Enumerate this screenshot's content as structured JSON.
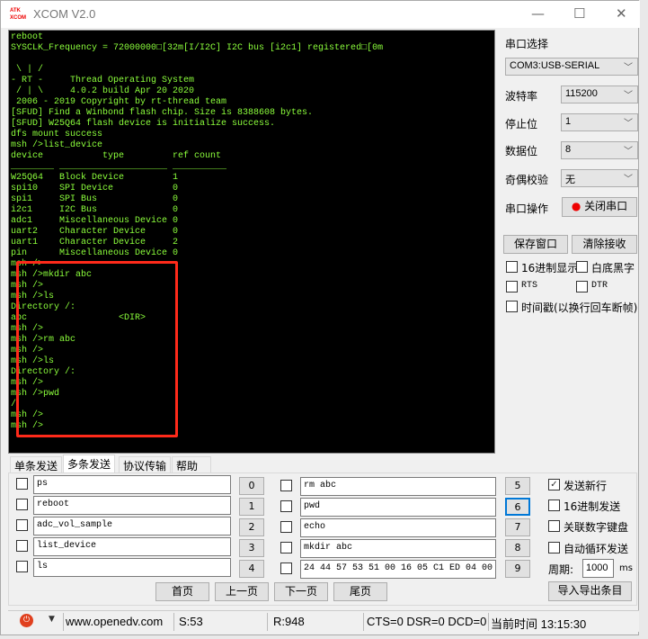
{
  "window": {
    "title": "XCOM V2.0",
    "logo": "ATK XCOM",
    "minimize": "—",
    "maximize": "☐",
    "close": "✕"
  },
  "terminal": {
    "lines": [
      "reboot",
      "SYSCLK_Frequency = 72000000□[32m[I/I2C] I2C bus [i2c1] registered□[0m",
      "",
      " \\ | /",
      "- RT -     Thread Operating System",
      " / | \\     4.0.2 build Apr 20 2020",
      " 2006 - 2019 Copyright by rt-thread team",
      "[SFUD] Find a Winbond flash chip. Size is 8388608 bytes.",
      "[SFUD] W25Q64 flash device is initialize success.",
      "dfs mount success",
      "msh />list_device",
      "device           type         ref count",
      "________ ____________________ __________",
      "W25Q64   Block Device         1",
      "spi10    SPI Device           0",
      "spi1     SPI Bus              0",
      "i2c1     I2C Bus              0",
      "adc1     Miscellaneous Device 0",
      "uart2    Character Device     0",
      "uart1    Character Device     2",
      "pin      Miscellaneous Device 0",
      "msh />",
      "msh />mkdir abc",
      "msh />",
      "msh />ls",
      "Directory /:",
      "abc                 <DIR>",
      "msh />",
      "msh />rm abc",
      "msh />",
      "msh />ls",
      "Directory /:",
      "msh />",
      "msh />pwd",
      "/",
      "msh />",
      "msh />"
    ],
    "text_color": "#8cff3c",
    "highlight_color": "#ff2a1a"
  },
  "settings": {
    "port_label": "串口选择",
    "port_value": "COM3:USB-SERIAL",
    "baud_label": "波特率",
    "baud_value": "115200",
    "stop_label": "停止位",
    "stop_value": "1",
    "data_label": "数据位",
    "data_value": "8",
    "parity_label": "奇偶校验",
    "parity_value": "无",
    "op_label": "串口操作",
    "op_button": "关闭串口",
    "save_button": "保存窗口",
    "clear_button": "清除接收",
    "hex_display": "16进制显示",
    "white_bg": "白底黑字",
    "rts": "RTS",
    "dtr": "DTR",
    "timestamp": "时间戳(以换行回车断帧)"
  },
  "tabs": [
    {
      "label": "单条发送"
    },
    {
      "label": "多条发送",
      "active": true
    },
    {
      "label": "协议传输"
    },
    {
      "label": "帮助"
    }
  ],
  "multi_send": {
    "left": [
      {
        "text": "ps",
        "btn": "0"
      },
      {
        "text": "reboot",
        "btn": "1"
      },
      {
        "text": "adc_vol_sample",
        "btn": "2"
      },
      {
        "text": "list_device",
        "btn": "3"
      },
      {
        "text": "ls",
        "btn": "4"
      }
    ],
    "right": [
      {
        "text": "rm abc",
        "btn": "5"
      },
      {
        "text": "pwd",
        "btn": "6"
      },
      {
        "text": "echo",
        "btn": "7"
      },
      {
        "text": "mkdir abc",
        "btn": "8"
      },
      {
        "text": "24 44 57 53 51 00 16 05 C1 ED 04 00",
        "btn": "9"
      }
    ],
    "options": {
      "newline": "发送新行",
      "newline_checked": true,
      "hex_send": "16进制发送",
      "numpad": "关联数字键盘",
      "auto_loop": "自动循环发送",
      "period_label": "周期:",
      "period_value": "1000",
      "period_unit": "ms"
    },
    "pages": {
      "first": "首页",
      "prev": "上一页",
      "next": "下一页",
      "last": "尾页"
    },
    "import_export": "导入导出条目"
  },
  "status": {
    "url": "www.openedv.com",
    "sent": "S:53",
    "received": "R:948",
    "lines": "CTS=0 DSR=0 DCD=0",
    "time": "当前时间 13:15:30"
  }
}
